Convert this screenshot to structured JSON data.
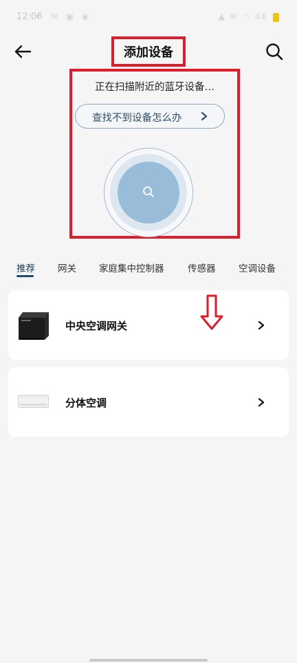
{
  "status_bar": {
    "time": "12:06",
    "battery": "48"
  },
  "header": {
    "title": "添加设备",
    "back_icon": "arrow-left-icon",
    "search_icon": "search-icon"
  },
  "scan": {
    "status_text": "正在扫描附近的蓝牙设备…",
    "help_label": "查找不到设备怎么办"
  },
  "tabs": [
    {
      "label": "推荐",
      "active": true
    },
    {
      "label": "网关",
      "active": false
    },
    {
      "label": "家庭集中控制器",
      "active": false
    },
    {
      "label": "传感器",
      "active": false
    },
    {
      "label": "空调设备",
      "active": false
    }
  ],
  "devices": [
    {
      "label": "中央空调网关",
      "icon": "gateway-device-icon"
    },
    {
      "label": "分体空调",
      "icon": "split-ac-icon"
    }
  ],
  "colors": {
    "highlight": "#e11b2a",
    "accent": "#1d4a78",
    "radar": "#99bdd8",
    "background": "#f5f5f5"
  }
}
